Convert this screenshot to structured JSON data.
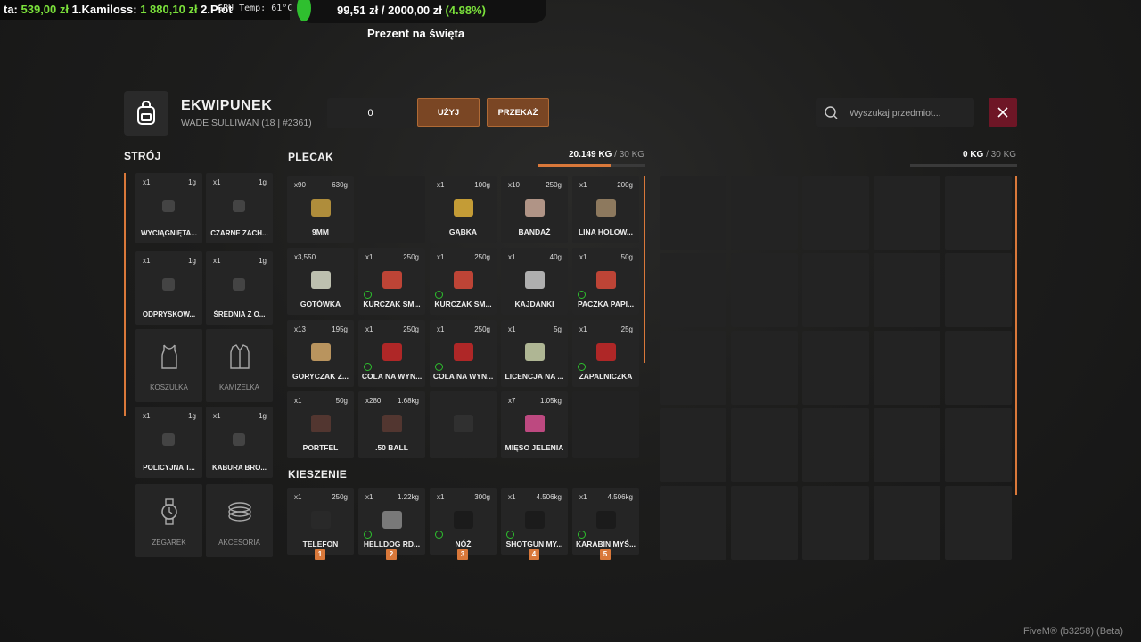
{
  "overlay": {
    "ticker_prefix": "ta: ",
    "ticker_amount1": "539,00 zł",
    "ticker_name1": " 1.Kamiloss: ",
    "ticker_amount2": "1 880,10 zł",
    "ticker_name2": " 2.Piot",
    "gpu_temp": "GPU Temp: 61°C",
    "progress_current": "99,51 zł",
    "progress_sep": " / ",
    "progress_goal": "2000,00 zł",
    "progress_pct": "(4.98%)",
    "progress_fraction": 0.0498,
    "progress_title": "Prezent na święta"
  },
  "header": {
    "title": "EKWIPUNEK",
    "subtitle": "WADE SULLIWAN (18 | #2361)",
    "quantity_value": "0",
    "use_label": "UŻYJ",
    "give_label": "PRZEKAŻ",
    "search_placeholder": "Wyszukaj przedmiot..."
  },
  "outfit": {
    "label": "STRÓJ",
    "slots": [
      {
        "count": "x1",
        "weight": "1g",
        "name": "WYCIĄGNIĘTA...",
        "filled": true
      },
      {
        "count": "x1",
        "weight": "1g",
        "name": "CZARNE ZACH...",
        "filled": true
      },
      {
        "count": "x1",
        "weight": "1g",
        "name": "ODPRYSKOW...",
        "filled": true
      },
      {
        "count": "x1",
        "weight": "1g",
        "name": "ŚREDNIA Z O...",
        "filled": true
      },
      {
        "count": "",
        "weight": "",
        "name": "KOSZULKA",
        "filled": false,
        "icon": "tank-top-icon"
      },
      {
        "count": "",
        "weight": "",
        "name": "KAMIZELKA",
        "filled": false,
        "icon": "vest-icon"
      },
      {
        "count": "x1",
        "weight": "1g",
        "name": "POLICYJNA T...",
        "filled": true
      },
      {
        "count": "x1",
        "weight": "1g",
        "name": "KABURA BRO...",
        "filled": true
      },
      {
        "count": "",
        "weight": "",
        "name": "ZEGAREK",
        "filled": false,
        "icon": "watch-icon"
      },
      {
        "count": "",
        "weight": "",
        "name": "AKCESORIA",
        "filled": false,
        "icon": "bracelet-icon"
      }
    ]
  },
  "backpack": {
    "label": "PLECAK",
    "weight": "20.149 KG",
    "max": "/ 30 KG",
    "weight_fraction": 0.672,
    "slots": [
      {
        "count": "x90",
        "weight": "630g",
        "name": "9MM",
        "icon": "ammo-icon",
        "color": "#c8a040"
      },
      {
        "count": "",
        "weight": "",
        "name": "",
        "icon": ""
      },
      {
        "count": "x1",
        "weight": "100g",
        "name": "GĄBKA",
        "icon": "sponge-icon",
        "color": "#e0b23a"
      },
      {
        "count": "x10",
        "weight": "250g",
        "name": "BANDAŻ",
        "icon": "bandage-icon",
        "color": "#c9a898"
      },
      {
        "count": "x1",
        "weight": "200g",
        "name": "LINA HOLOW...",
        "icon": "rope-icon",
        "color": "#a08868"
      },
      {
        "count": "x3,550",
        "weight": "",
        "name": "GOTÓWKA",
        "icon": "cash-icon",
        "color": "#d8dcc8"
      },
      {
        "count": "x1",
        "weight": "250g",
        "name": "KURCZAK SM...",
        "icon": "chicken-bucket-icon",
        "color": "#d84a3a",
        "durability": true
      },
      {
        "count": "x1",
        "weight": "250g",
        "name": "KURCZAK SM...",
        "icon": "chicken-bucket-icon",
        "color": "#d84a3a",
        "durability": true
      },
      {
        "count": "x1",
        "weight": "40g",
        "name": "KAJDANKI",
        "icon": "handcuffs-icon",
        "color": "#c8c8c8"
      },
      {
        "count": "x1",
        "weight": "50g",
        "name": "PACZKA PAPI...",
        "icon": "cigarette-pack-icon",
        "color": "#d84a3a",
        "durability": true
      },
      {
        "count": "x13",
        "weight": "195g",
        "name": "GORYCZAK Z...",
        "icon": "mushroom-icon",
        "color": "#d4a868"
      },
      {
        "count": "x1",
        "weight": "250g",
        "name": "COLA NA WYN...",
        "icon": "cola-cup-icon",
        "color": "#c82828",
        "durability": true
      },
      {
        "count": "x1",
        "weight": "250g",
        "name": "COLA NA WYN...",
        "icon": "cola-cup-icon",
        "color": "#c82828",
        "durability": true
      },
      {
        "count": "x1",
        "weight": "5g",
        "name": "LICENCJA NA ...",
        "icon": "license-icon",
        "color": "#c8d0a8"
      },
      {
        "count": "x1",
        "weight": "25g",
        "name": "ZAPALNICZKA",
        "icon": "lighter-icon",
        "color": "#c82828",
        "durability": true
      },
      {
        "count": "x1",
        "weight": "50g",
        "name": "PORTFEL",
        "icon": "wallet-icon",
        "color": "#5a3a32"
      },
      {
        "count": "x280",
        "weight": "1.68kg",
        "name": ".50 BALL",
        "icon": "bullet-icon",
        "color": "#5a3a32"
      },
      {
        "count": "",
        "weight": "",
        "name": "",
        "icon": "hidden-item-icon",
        "color": "#333"
      },
      {
        "count": "x7",
        "weight": "1.05kg",
        "name": "MIĘSO JELENIA",
        "icon": "meat-icon",
        "color": "#d85090"
      },
      {
        "count": "",
        "weight": "",
        "name": "",
        "icon": ""
      }
    ]
  },
  "pockets": {
    "label": "KIESZENIE",
    "slots": [
      {
        "count": "x1",
        "weight": "250g",
        "name": "TELEFON",
        "icon": "phone-icon",
        "color": "#2a2a2a",
        "hotkey": "1"
      },
      {
        "count": "x1",
        "weight": "1.22kg",
        "name": "HELLDOG RD...",
        "icon": "pistol-icon",
        "color": "#888",
        "hotkey": "2",
        "durability": true
      },
      {
        "count": "x1",
        "weight": "300g",
        "name": "NÓŻ",
        "icon": "knife-icon",
        "color": "#1a1a1a",
        "hotkey": "3",
        "durability": true
      },
      {
        "count": "x1",
        "weight": "4.506kg",
        "name": "SHOTGUN MY...",
        "icon": "shotgun-icon",
        "color": "#1a1a1a",
        "hotkey": "4",
        "durability": true
      },
      {
        "count": "x1",
        "weight": "4.506kg",
        "name": "KARABIN MYŚ...",
        "icon": "rifle-icon",
        "color": "#1a1a1a",
        "hotkey": "5",
        "durability": true
      }
    ]
  },
  "ground": {
    "weight": "0 KG",
    "max": "/ 30 KG"
  },
  "footer": {
    "build": "FiveM® (b3258) (Beta)"
  }
}
